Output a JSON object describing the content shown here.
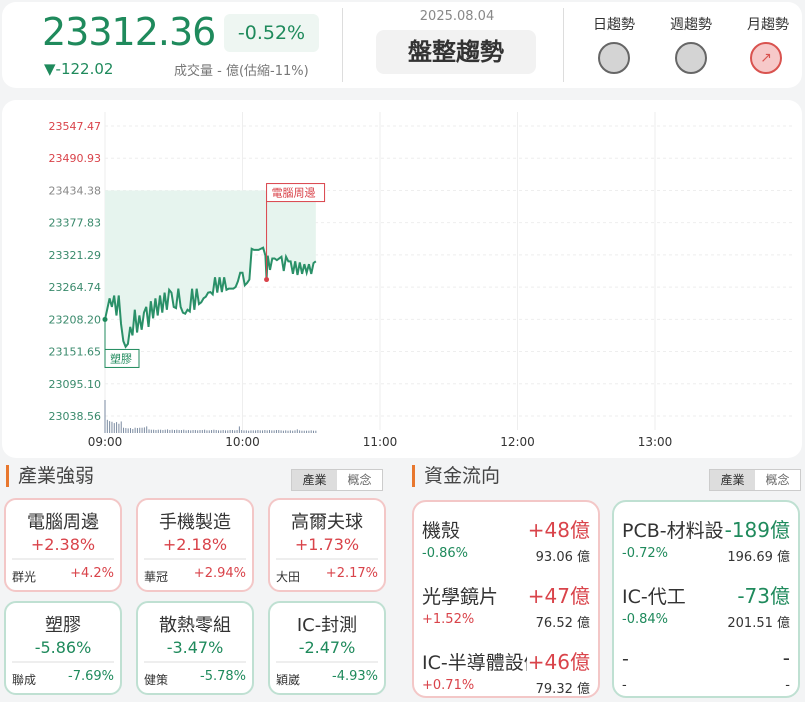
{
  "header": {
    "price": "23312.36",
    "change_pct": "-0.52%",
    "change": "▼-122.02",
    "volume": "成交量 - 億(估縮-11%)",
    "date": "2025.08.04",
    "trend": "盤整趨勢",
    "indicators": [
      {
        "label": "日趨勢",
        "state": "neutral"
      },
      {
        "label": "週趨勢",
        "state": "neutral"
      },
      {
        "label": "月趨勢",
        "state": "up",
        "icon": "trending-up-icon"
      }
    ]
  },
  "colors": {
    "up": "#d9434a",
    "down": "#1f8a5c",
    "accent": "#e8772e"
  },
  "chart_data": {
    "type": "line",
    "y_ticks": [
      "23547.47",
      "23490.93",
      "23434.38",
      "23377.83",
      "23321.29",
      "23264.74",
      "23208.20",
      "23151.65",
      "23095.10",
      "23038.56"
    ],
    "x_ticks": [
      "09:00",
      "10:00",
      "11:00",
      "12:00",
      "13:00"
    ],
    "ylim": [
      23038.56,
      23547.47
    ],
    "reference": 23434.38,
    "series": {
      "minutes": [
        0,
        2,
        3,
        4,
        5,
        6,
        7,
        8,
        9,
        10,
        11,
        12,
        13,
        14,
        15,
        16,
        17,
        18,
        19,
        20,
        21,
        22,
        23,
        24,
        25,
        26,
        27,
        28,
        29,
        30,
        31,
        32,
        33,
        34,
        35,
        36,
        37,
        38,
        39,
        40,
        41,
        42,
        43,
        44,
        45,
        46,
        47,
        48,
        49,
        50,
        51,
        52,
        53,
        54,
        55,
        56,
        57,
        58,
        59,
        60,
        61,
        62,
        63,
        64,
        65,
        66,
        67,
        68,
        69,
        70,
        70.5,
        71,
        72,
        73,
        74,
        75,
        76,
        77,
        78,
        79,
        80,
        81,
        82,
        83,
        84,
        85,
        86,
        87,
        88,
        89,
        90,
        91,
        92
      ],
      "price": [
        23208,
        23245,
        23230,
        23250,
        23215,
        23250,
        23200,
        23170,
        23160,
        23165,
        23195,
        23180,
        23225,
        23185,
        23215,
        23190,
        23220,
        23230,
        23195,
        23240,
        23210,
        23245,
        23215,
        23250,
        23220,
        23255,
        23225,
        23260,
        23255,
        23230,
        23228,
        23262,
        23230,
        23220,
        23218,
        23225,
        23222,
        23262,
        23225,
        23262,
        23235,
        23238,
        23245,
        23248,
        23255,
        23256,
        23252,
        23282,
        23255,
        23282,
        23256,
        23282,
        23260,
        23262,
        23262,
        23262,
        23265,
        23275,
        23290,
        23290,
        23268,
        23272,
        23278,
        23332,
        23330,
        23330,
        23330,
        23332,
        23334,
        23320,
        23278,
        23320,
        23295,
        23315,
        23315,
        23312,
        23315,
        23318,
        23293,
        23318,
        23310,
        23310,
        23288,
        23310,
        23286,
        23308,
        23288,
        23305,
        23290,
        23305,
        23288,
        23307,
        23310
      ]
    },
    "volume": [
      10,
      4,
      3.6,
      3.4,
      3,
      3.3,
      2.8,
      3.5,
      1.6,
      1.5,
      1.4,
      1.5,
      1.2,
      1.6,
      1.5,
      1.6,
      1.6,
      1.7,
      2,
      1.1,
      1,
      1,
      0.9,
      1,
      1,
      0.9,
      1,
      1.1,
      0.9,
      1,
      0.9,
      1,
      0.9,
      0.9,
      1,
      0.8,
      0.9,
      0.8,
      0.9,
      0.9,
      0.8,
      0.9,
      0.9,
      1,
      0.8,
      0.8,
      0.9,
      1,
      0.9,
      0.8,
      0.8,
      0.9,
      0.8,
      0.8,
      0.9,
      0.9,
      0.8,
      0.9,
      2,
      0.9,
      0.8,
      0.8,
      0.7,
      0.8,
      0.8,
      0.8,
      0.9,
      0.8,
      0.8,
      0.9,
      0.8,
      0.9,
      0.8,
      0.8,
      0.9,
      0.9,
      0.8,
      0.7,
      0.8,
      0.7,
      0.8,
      0.7,
      0.8,
      1.1,
      0.8,
      0.7,
      0.7,
      0.7,
      0.7,
      0.8,
      0.7,
      0.7
    ],
    "annotations": [
      {
        "label": "塑膠",
        "minute": 0,
        "price": 23208,
        "color": "#1f8a5c"
      },
      {
        "label": "電腦周邊",
        "minute": 70.5,
        "price": 23278,
        "color": "#d9434a"
      }
    ]
  },
  "industry": {
    "title": "產業強弱",
    "tabs": [
      "產業",
      "概念"
    ],
    "items": [
      {
        "name": "電腦周邊",
        "pct": "+2.38%",
        "stock": "群光",
        "stock_pct": "+4.2%",
        "dir": "up"
      },
      {
        "name": "手機製造",
        "pct": "+2.18%",
        "stock": "華冠",
        "stock_pct": "+2.94%",
        "dir": "up"
      },
      {
        "name": "高爾夫球",
        "pct": "+1.73%",
        "stock": "大田",
        "stock_pct": "+2.17%",
        "dir": "up"
      },
      {
        "name": "塑膠",
        "pct": "-5.86%",
        "stock": "聯成",
        "stock_pct": "-7.69%",
        "dir": "dn"
      },
      {
        "name": "散熱零組",
        "pct": "-3.47%",
        "stock": "健策",
        "stock_pct": "-5.78%",
        "dir": "dn"
      },
      {
        "name": "IC-封測",
        "pct": "-2.47%",
        "stock": "穎崴",
        "stock_pct": "-4.93%",
        "dir": "dn"
      }
    ]
  },
  "flow": {
    "title": "資金流向",
    "tabs": [
      "產業",
      "概念"
    ],
    "inflow": [
      {
        "name": "機殼",
        "amount": "+48億",
        "pct": "-0.86%",
        "value": "93.06 億",
        "pct_dir": "dn"
      },
      {
        "name": "光學鏡片",
        "amount": "+47億",
        "pct": "+1.52%",
        "value": "76.52 億",
        "pct_dir": "up"
      },
      {
        "name": "IC-半導體設備",
        "amount": "+46億",
        "pct": "+0.71%",
        "value": "79.32 億",
        "pct_dir": "up"
      }
    ],
    "outflow": [
      {
        "name": "PCB-材料設備",
        "amount": "-189億",
        "pct": "-0.72%",
        "value": "196.69 億",
        "pct_dir": "dn"
      },
      {
        "name": "IC-代工",
        "amount": "-73億",
        "pct": "-0.84%",
        "value": "201.51 億",
        "pct_dir": "dn"
      },
      {
        "name": "-",
        "amount": "-",
        "pct": "-",
        "value": "-",
        "pct_dir": "none"
      }
    ]
  }
}
